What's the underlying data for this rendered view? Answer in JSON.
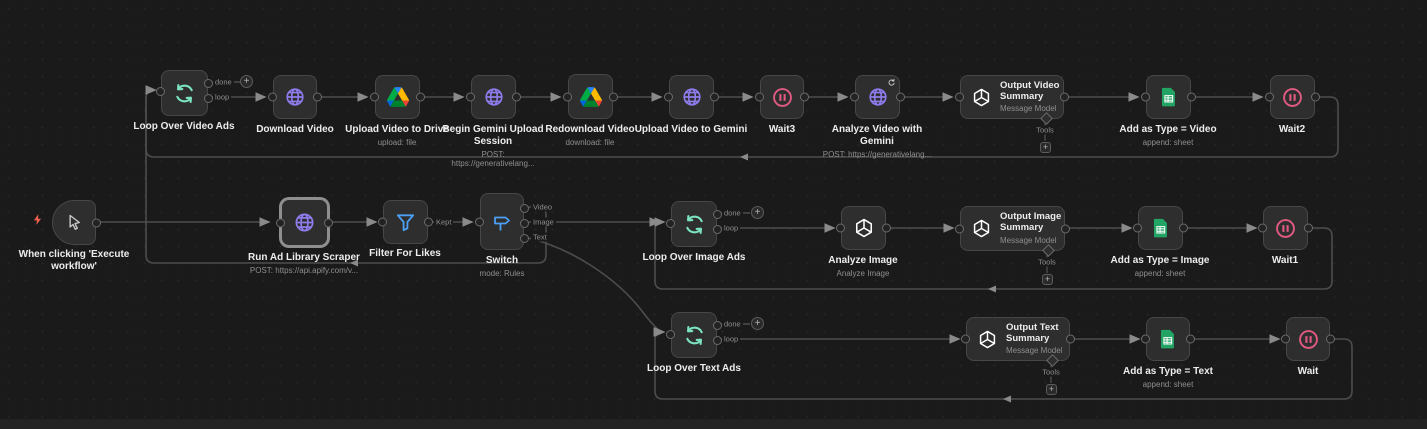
{
  "workflow": {
    "description": "n8n-style workflow canvas with three looped branches (video, image, text ad analysis)"
  },
  "colors": {
    "canvas": "#1a1a1a",
    "node_bg": "#2e2e2e",
    "node_border": "#474747",
    "wire": "#4d4d4d",
    "label": "#ededed",
    "sublabel": "#8f8f8f",
    "loop_icon": "#7be3c0",
    "http_icon": "#8d7cec",
    "wait_icon": "#e15a82",
    "filter_icon": "#4ba0f5",
    "switch_icon": "#4ba0f5",
    "sheets_green": "#21a464",
    "drive_blue": "#2684fc",
    "drive_green": "#00ac47",
    "drive_yellow": "#ffba00",
    "openai_icon": "#ffffff",
    "bolt_icon": "#f4604f",
    "selected_border": "#8f8f8f"
  },
  "port_labels": {
    "done": "done",
    "loop": "loop",
    "kept": "Kept",
    "video": "Video",
    "image": "Image",
    "text": "Text",
    "tools": "Tools"
  },
  "nodes": {
    "loop_video": {
      "label": "Loop Over Video Ads"
    },
    "download_video": {
      "label": "Download Video"
    },
    "upload_drive": {
      "label": "Upload Video to Drive",
      "sub": "upload: file"
    },
    "begin_gemini": {
      "label": "Begin Gemini Upload Session",
      "sub": "POST: https://generativelang..."
    },
    "redownload_video": {
      "label": "Redownload Video",
      "sub": "download: file"
    },
    "upload_gemini": {
      "label": "Upload Video to Gemini"
    },
    "wait3": {
      "label": "Wait3"
    },
    "analyze_video": {
      "label": "Analyze Video with Gemini",
      "sub": "POST: https://generativelang..."
    },
    "output_video": {
      "title": "Output Video Summary",
      "sub": "Message Model"
    },
    "add_video": {
      "label": "Add as Type = Video",
      "sub": "append: sheet"
    },
    "wait2": {
      "label": "Wait2"
    },
    "trigger": {
      "label": "When clicking 'Execute workflow'"
    },
    "run_scraper": {
      "label": "Run Ad Library Scraper",
      "sub": "POST: https://api.apify.com/v..."
    },
    "filter": {
      "label": "Filter For Likes"
    },
    "switch": {
      "label": "Switch",
      "sub": "mode: Rules"
    },
    "loop_image": {
      "label": "Loop Over Image Ads"
    },
    "analyze_image": {
      "label": "Analyze Image",
      "sub": "Analyze Image"
    },
    "output_image": {
      "title": "Output Image Summary",
      "sub": "Message Model"
    },
    "add_image": {
      "label": "Add as Type = Image",
      "sub": "append: sheet"
    },
    "wait1": {
      "label": "Wait1"
    },
    "loop_text": {
      "label": "Loop Over Text Ads"
    },
    "output_text": {
      "title": "Output Text Summary",
      "sub": "Message Model"
    },
    "add_text": {
      "label": "Add as Type = Text",
      "sub": "append: sheet"
    },
    "wait": {
      "label": "Wait"
    }
  },
  "endpoints": {
    "plus": "+"
  }
}
